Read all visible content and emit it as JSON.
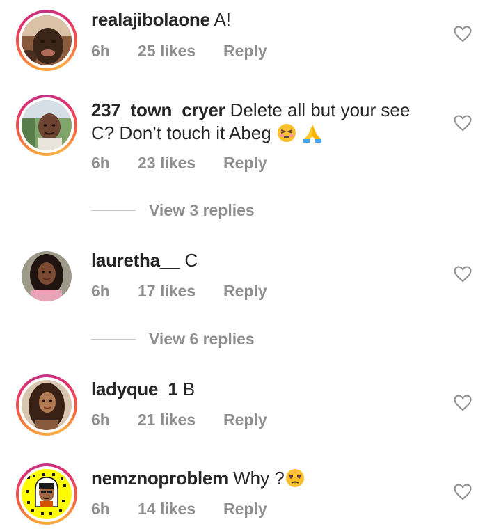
{
  "comments": [
    {
      "username": "realajibolaone",
      "text": "A!",
      "time": "6h",
      "likes": "25 likes",
      "reply": "Reply",
      "avatar": "person-selfie-dark",
      "story_ring": true
    },
    {
      "username": "237_town_cryer",
      "text_line1": "Delete all but your see",
      "text_line2": "C? Don’t touch it Abeg",
      "emojis": [
        "persevering-face-emoji",
        "folded-hands-emoji"
      ],
      "time": "6h",
      "likes": "23 likes",
      "reply": "Reply",
      "avatar": "person-outdoor",
      "story_ring": true,
      "view_replies": "View 3 replies"
    },
    {
      "username": "lauretha__",
      "text": "C",
      "time": "6h",
      "likes": "17 likes",
      "reply": "Reply",
      "avatar": "woman-portrait",
      "story_ring": false,
      "view_replies": "View 6 replies"
    },
    {
      "username": "ladyque_1",
      "text": "B",
      "time": "6h",
      "likes": "21 likes",
      "reply": "Reply",
      "avatar": "woman-long-hair",
      "story_ring": true
    },
    {
      "username": "nemznoproblem",
      "text": "Why ?",
      "emojis": [
        "unamused-face-emoji"
      ],
      "time": "6h",
      "likes": "14 likes",
      "reply": "Reply",
      "avatar": "snapcode-bitmoji",
      "story_ring": true
    }
  ],
  "colors": {
    "text": "#262626",
    "meta": "#8e8e8e",
    "rule": "#c7c7c7",
    "snap_yellow": "#FFFC00"
  },
  "icons": {
    "like": "heart-outline-icon"
  }
}
